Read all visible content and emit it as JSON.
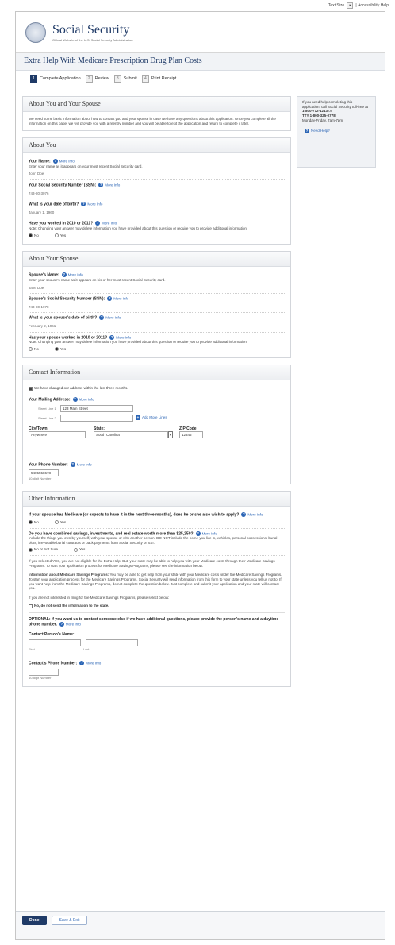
{
  "topbar": {
    "text_size": "Text Size",
    "accessibility": "Accessibility Help"
  },
  "brand": {
    "title": "Social Security",
    "subtitle": "Official Website of the U.S. Social Security Administration"
  },
  "page_title": "Extra Help With Medicare Prescription Drug Plan Costs",
  "steps": [
    {
      "num": "1",
      "label": "Complete Application"
    },
    {
      "num": "2",
      "label": "Review"
    },
    {
      "num": "3",
      "label": "Submit"
    },
    {
      "num": "4",
      "label": "Print Receipt"
    }
  ],
  "side": {
    "line1": "If you need help completing this application, call Social Security toll-free at",
    "phone": "1-800-772-1213",
    "or": "or",
    "tty": "TTY 1-800-325-0778,",
    "hours": "Monday-Friday, 7am-7pm",
    "need_help": "Need Help?"
  },
  "more_info": "More Info",
  "about_you_spouse": {
    "heading": "About You and Your Spouse",
    "intro": "We need some basic information about how to contact you and your spouse in case we have any questions about this application. Once you complete all the information on this page, we will provide you with a reentry number and you will be able to exit the application and return to complete it later."
  },
  "about_you": {
    "heading": "About You",
    "name_label": "Your Name:",
    "name_hint": "Enter your name as it appears on your most recent Social Security card.",
    "name_value": "John Doe",
    "ssn_label": "Your Social Security Number (SSN):",
    "ssn_value": "743-80-3076",
    "dob_label": "What is your date of birth?",
    "dob_value": "January 1, 1960",
    "worked_label": "Have you worked in 2010 or 2011?",
    "note": "Note: Changing your answer may delete information you have provided about this question or require you to provide additional information.",
    "no": "No",
    "yes": "Yes"
  },
  "about_spouse": {
    "heading": "About Your Spouse",
    "name_label": "Spouse's Name:",
    "name_hint": "Enter your spouse's name as it appears on his or her most recent Social Security card.",
    "name_value": "Jane Doe",
    "ssn_label": "Spouse's Social Security Number (SSN):",
    "ssn_value": "743-80-1078",
    "dob_label": "What is your spouse's date of birth?",
    "dob_value": "February 2, 1961",
    "worked_label": "Has your spouse worked in 2010 or 2011?",
    "note": "Note: Changing your answer may delete information you have provided about this question or require you to provide additional information.",
    "no": "No",
    "yes": "Yes"
  },
  "contact": {
    "heading": "Contact Information",
    "changed": "We have changed our address within the last three months.",
    "mailing_label": "Your Mailing Address:",
    "street1_label": "Street Line 1",
    "street1_value": "123 Main Street",
    "street2_label": "Street Line 2",
    "add_more": "Add More Lines",
    "city_label": "City/Town:",
    "city_value": "Anywhere",
    "state_label": "State:",
    "state_value": "South Carolina",
    "zip_label": "ZIP Code:",
    "zip_value": "12345",
    "phone_label": "Your Phone Number:",
    "phone_value": "5405558678",
    "phone_hint": "10-digit Number"
  },
  "other": {
    "heading": "Other Information",
    "q1": "If your spouse has Medicare (or expects to have it in the next three months), does he or she also wish to apply?",
    "q1_no": "No",
    "q1_yes": "Yes",
    "q2": "Do you have combined savings, investments, and real estate worth more than $25,250?",
    "q2_hint": "Include the things you own by yourself, with your spouse or with another person. DO NOT include the home you live in, vehicles, personal possessions, burial plots, irrevocable burial contracts or back payments from Social Security or SSI.",
    "q2_no": "No or Not Sure",
    "q2_yes": "Yes",
    "p1": "If you selected YES, you are not eligible for the Extra Help. But, your state may be able to help you with your Medicare costs through their Medicare Savings Programs. To start your application process for Medicare Savings Programs, please see the information below.",
    "p2_label": "Information about Medicare Savings Programs:",
    "p2": "You may be able to get help from your state with your Medicare costs under the Medicare Savings Programs. To start your application process for the Medicare Savings Programs, Social Security will send information from this form to your state unless you tell us not to. If you want help from the Medicare Savings Programs, do not complete the question below. Just complete and submit your application and your state will contact you.",
    "p3": "If you are not interested in filing for the Medicare Savings Programs, please select below:",
    "no_send": "No, do not send the information to the state.",
    "optional": "OPTIONAL: If you want us to contact someone else if we have additional questions, please provide the person's name and a daytime phone number.",
    "contact_name_label": "Contact Person's Name:",
    "first": "First",
    "last": "Last",
    "contact_phone_label": "Contact's Phone Number:",
    "phone_hint": "10-digit Number"
  },
  "buttons": {
    "done": "Done",
    "save_exit": "Save & Exit"
  }
}
